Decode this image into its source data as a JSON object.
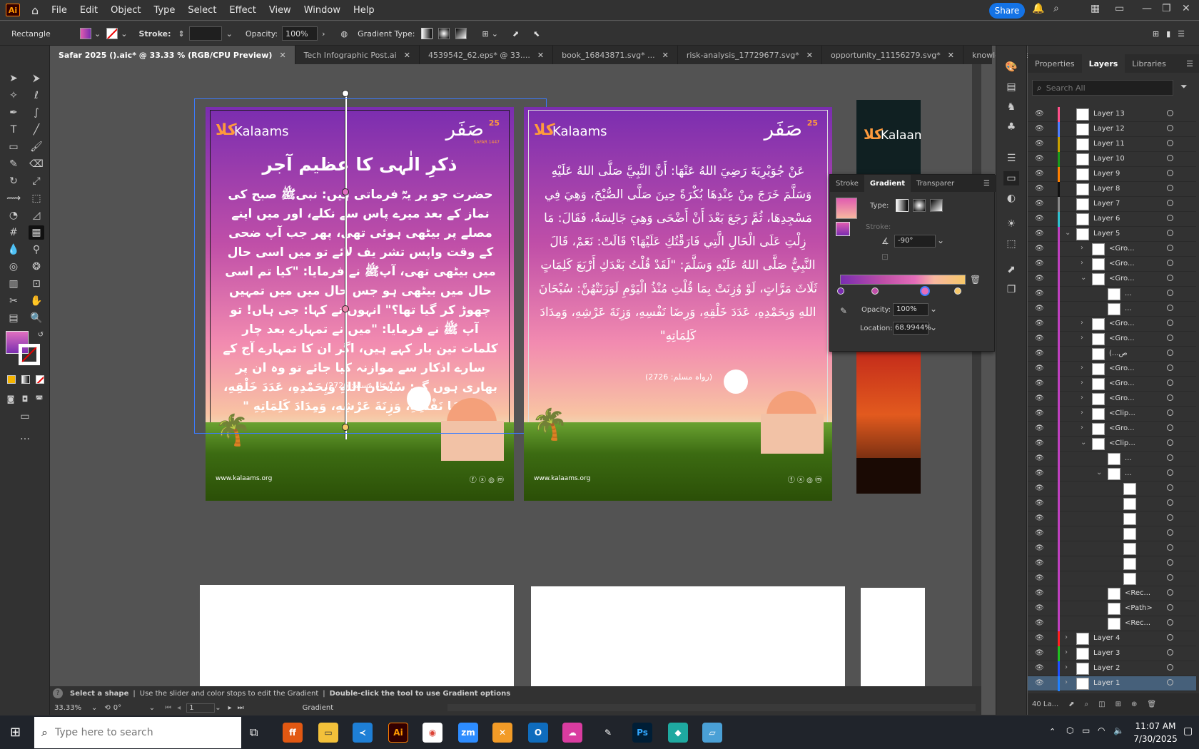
{
  "menu": {
    "items": [
      "File",
      "Edit",
      "Object",
      "Type",
      "Select",
      "Effect",
      "View",
      "Window",
      "Help"
    ],
    "share": "Share"
  },
  "control": {
    "shape": "Rectangle",
    "stroke_label": "Stroke:",
    "opacity_label": "Opacity:",
    "opacity": "100%",
    "gradient_type_label": "Gradient Type:"
  },
  "tabs": [
    {
      "label": "Safar 2025 ().aic* @ 33.33 % (RGB/CPU Preview)",
      "active": true
    },
    {
      "label": "Tech Infographic Post.ai"
    },
    {
      "label": "4539542_62.eps* @ 33...."
    },
    {
      "label": "book_16843871.svg* ..."
    },
    {
      "label": "risk-analysis_17729677.svg*"
    },
    {
      "label": "opportunity_11156279.svg*"
    },
    {
      "label": "knowledge-managem"
    }
  ],
  "poster": {
    "brand": "Kalaams",
    "brand_glyph": "کلا",
    "safar": "صَفَر",
    "safar_num": "25",
    "safar_sub": "SAFAR 1447",
    "title": "ذکرِ الٰہی کا عظیم آجر",
    "body": "حضرت جو یر یہؓ فرماتی ہیں: نبیﷺ صبح کی نماز کے بعد میرے پاس سے نکلے، اور میں اپنے مصلے پر بیٹھی ہوئی تھی، پھر جب آپ ضحی کے وقت واپس تشر یف لائے تو میں اسی حال میں بیٹھی تھی، آپﷺ نے فرمایا: \"کیا تم اسی حال میں بیٹھی ہو جس حال میں میں تمہیں چھوڑ کر گیا تھا؟\" انہوں نے کہا: جی ہاں! تو آپ ﷺ نے فرمایا: \"میں نے تمہارے بعد چار کلمات تین بار کہے ہیں، اگر ان کا تمہارے آج کے سارے اذکار سے موازنہ کیا جائے تو وہ ان پر بھاری ہوں گے: سُبْحَانَ اللهِ وَبِحَمْدِهِ، عَدَدَ خَلْقِهِ، وَرِضَا نَفْسِهِ، وَزِنَةَ عَرْشِهِ، وَمِدَادَ كَلِمَاتِهِ \"",
    "ref": "(رواہ مسلم: 2726)",
    "arabic": "عَنْ جُوَيْرِيَةَ رَضِيَ اللهُ عَنْهَا: أَنَّ النَّبِيَّ صَلَّى اللهُ عَلَيْهِ وَسَلَّمَ خَرَجَ مِنْ عِنْدِهَا بُكْرَةً حِينَ صَلَّى الصُّبْحَ، وَهِيَ فِي مَسْجِدِهَا، ثُمَّ رَجَعَ بَعْدَ أَنْ أَضْحَى وَهِيَ جَالِسَةٌ، فَقَالَ: مَا زِلْتِ عَلَى الْحَالِ الَّتِي فَارَقْتُكِ عَلَيْهَا؟ قَالَتْ: نَعَمْ، قَالَ النَّبِيُّ صَلَّى اللهُ عَلَيْهِ وَسَلَّمَ: \"لَقَدْ قُلْتُ بَعْدَكِ أَرْبَعَ كَلِمَاتٍ ثَلَاثَ مَرَّاتٍ، لَوْ وُزِنَتْ بِمَا قُلْتِ مُنْذُ الْيَوْمِ لَوَزَنَتْهُنَّ: سُبْحَانَ اللهِ وَبِحَمْدِهِ، عَدَدَ خَلْقِهِ، وَرِضَا نَفْسِهِ، وَزِنَةَ عَرْشِهِ، وَمِدَادَ كَلِمَاتِهِ\"",
    "ref_ar": "(رواہ مسلم: 2726)",
    "website": "www.kalaams.org",
    "social": "ⓕ ⓧ ◎ ⓜ"
  },
  "gradient_panel": {
    "tabs": [
      "Stroke",
      "Gradient",
      "Transparer"
    ],
    "type_label": "Type:",
    "stroke_label": "Stroke:",
    "angle": "-90°",
    "opacity_label": "Opacity:",
    "opacity": "100%",
    "location_label": "Location:",
    "location": "68.9944%"
  },
  "layers_panel": {
    "tabs": [
      "Properties",
      "Layers",
      "Libraries"
    ],
    "search_placeholder": "Search All",
    "footer": "40 La...",
    "rows": [
      {
        "name": "Layer 13",
        "ind": 0,
        "color": "#ff4f8a"
      },
      {
        "name": "Layer 12",
        "ind": 0,
        "color": "#4f7fff"
      },
      {
        "name": "Layer 11",
        "ind": 0,
        "color": "#c8a000"
      },
      {
        "name": "Layer 10",
        "ind": 0,
        "color": "#1a9a1a"
      },
      {
        "name": "Layer 9",
        "ind": 0,
        "color": "#ff7f00"
      },
      {
        "name": "Layer 8",
        "ind": 0,
        "color": "#111111"
      },
      {
        "name": "Layer 7",
        "ind": 0,
        "color": "#888888"
      },
      {
        "name": "Layer 6",
        "ind": 0,
        "color": "#30c0d0"
      },
      {
        "name": "Layer 5",
        "ind": 0,
        "color": "#c040c0",
        "open": true
      },
      {
        "name": "<Gro...",
        "ind": 1,
        "color": "#c040c0",
        "arr": ">"
      },
      {
        "name": "<Gro...",
        "ind": 1,
        "color": "#c040c0",
        "arr": ">"
      },
      {
        "name": "<Gro...",
        "ind": 1,
        "color": "#c040c0",
        "open": true
      },
      {
        "name": "...",
        "ind": 2,
        "color": "#c040c0"
      },
      {
        "name": "...",
        "ind": 2,
        "color": "#c040c0"
      },
      {
        "name": "<Gro...",
        "ind": 1,
        "color": "#c040c0",
        "arr": ">"
      },
      {
        "name": "<Gro...",
        "ind": 1,
        "color": "#c040c0",
        "arr": ">"
      },
      {
        "name": "(...ص",
        "ind": 1,
        "color": "#c040c0"
      },
      {
        "name": "<Gro...",
        "ind": 1,
        "color": "#c040c0",
        "arr": ">"
      },
      {
        "name": "<Gro...",
        "ind": 1,
        "color": "#c040c0",
        "arr": ">"
      },
      {
        "name": "<Gro...",
        "ind": 1,
        "color": "#c040c0",
        "arr": ">"
      },
      {
        "name": "<Clip...",
        "ind": 1,
        "color": "#c040c0",
        "arr": ">"
      },
      {
        "name": "<Gro...",
        "ind": 1,
        "color": "#c040c0",
        "arr": ">"
      },
      {
        "name": "<Clip...",
        "ind": 1,
        "color": "#c040c0",
        "open": true
      },
      {
        "name": "...",
        "ind": 2,
        "color": "#c040c0"
      },
      {
        "name": "...",
        "ind": 2,
        "color": "#c040c0",
        "open": true
      },
      {
        "name": "",
        "ind": 3,
        "color": "#c040c0"
      },
      {
        "name": "",
        "ind": 3,
        "color": "#c040c0"
      },
      {
        "name": "",
        "ind": 3,
        "color": "#c040c0"
      },
      {
        "name": "",
        "ind": 3,
        "color": "#c040c0"
      },
      {
        "name": "",
        "ind": 3,
        "color": "#c040c0"
      },
      {
        "name": "",
        "ind": 3,
        "color": "#c040c0"
      },
      {
        "name": "",
        "ind": 3,
        "color": "#c040c0"
      },
      {
        "name": "<Rec...",
        "ind": 2,
        "color": "#c040c0"
      },
      {
        "name": "<Path>",
        "ind": 2,
        "color": "#c040c0"
      },
      {
        "name": "<Rec...",
        "ind": 2,
        "color": "#c040c0"
      },
      {
        "name": "Layer 4",
        "ind": 0,
        "color": "#ff2020",
        "arr": ">"
      },
      {
        "name": "Layer 3",
        "ind": 0,
        "color": "#20c020",
        "arr": ">"
      },
      {
        "name": "Layer 2",
        "ind": 0,
        "color": "#2050ff",
        "arr": ">"
      },
      {
        "name": "Layer 1",
        "ind": 0,
        "color": "#2080ff",
        "arr": ">",
        "selected": true
      }
    ]
  },
  "status": {
    "hint_a": "Select a shape",
    "hint_b": "Use the slider and color stops to edit the Gradient",
    "hint_c": "Double-click the tool to use Gradient options",
    "zoom": "33.33%",
    "rotate": "0°",
    "page": "1",
    "tool": "Gradient"
  },
  "taskbar": {
    "search_placeholder": "Type here to search",
    "time": "11:07 AM",
    "date": "7/30/2025"
  }
}
